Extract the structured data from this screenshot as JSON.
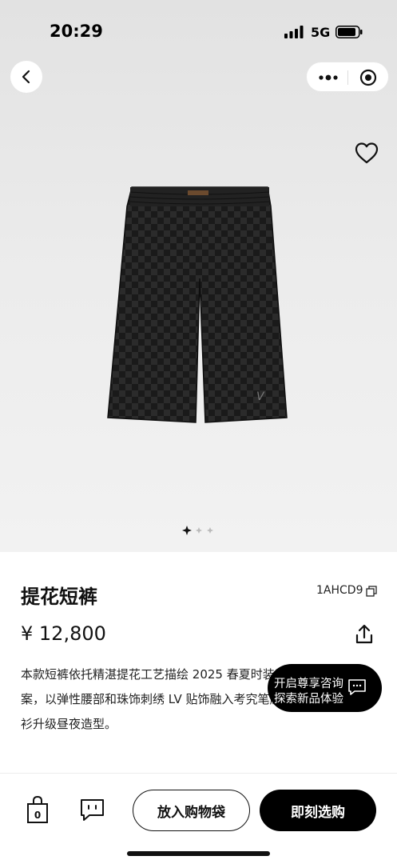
{
  "status": {
    "time": "20:29",
    "network": "5G"
  },
  "product": {
    "title": "提花短裤",
    "sku": "1AHCD9",
    "price": "¥ 12,800",
    "description": [
      "本款短裤依托精湛提花工艺描绘 2025 春夏时装秀的",
      "案，以弹性腰部和珠饰刺绣 LV 贴饰融入考究笔触",
      "衫升级昼夜造型。"
    ],
    "image_count": 3,
    "active_image": 1
  },
  "concierge": {
    "line1": "开启尊享咨询",
    "line2": "探索新品体验"
  },
  "bottom": {
    "bag_count": "0",
    "add_to_bag": "放入购物袋",
    "buy_now": "即刻选购"
  },
  "icons": {
    "back": "chevron-left-icon",
    "more": "more-dots-icon",
    "close": "target-icon",
    "favorite": "heart-icon",
    "copy": "copy-icon",
    "share": "share-icon",
    "bag": "shopping-bag-icon",
    "chat": "chat-bubble-icon"
  },
  "colors": {
    "accent": "#000000",
    "hero_bg": "#ebebeb"
  }
}
